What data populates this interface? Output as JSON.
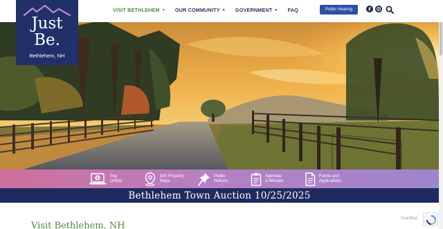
{
  "logo": {
    "line1": "Just",
    "line2": "Be.",
    "place": "Bethlehem, NH"
  },
  "nav": {
    "items": [
      {
        "label": "VISIT BETHLEHEM",
        "has_dropdown": true,
        "active": true
      },
      {
        "label": "OUR COMMUNITY",
        "has_dropdown": true,
        "active": false
      },
      {
        "label": "GOVERNMENT",
        "has_dropdown": true,
        "active": false
      },
      {
        "label": "FAQ",
        "has_dropdown": false,
        "active": false
      }
    ]
  },
  "header": {
    "cta_label": "Public Hearing",
    "social": [
      "facebook-icon",
      "instagram-icon"
    ],
    "search_icon": "search-icon"
  },
  "quick_links": [
    {
      "label": "Pay\nOnline",
      "icon": "laptop-dollar-icon"
    },
    {
      "label": "GIS Property\nMaps",
      "icon": "map-pin-icon"
    },
    {
      "label": "Public\nNotices",
      "icon": "pushpin-icon"
    },
    {
      "label": "Agendas\n& Minutes",
      "icon": "clipboard-icon"
    },
    {
      "label": "Forms and\nApplications",
      "icon": "document-icon"
    }
  ],
  "banner": {
    "text": "Bethlehem Town Auction 10/25/2025"
  },
  "section": {
    "title": "Visit Bethlehem, NH"
  },
  "widgets": {
    "scanmail_label": "ScanMail"
  },
  "colors": {
    "nav_active": "#4c8a3c",
    "nav": "#2d2f5e",
    "logo_bg": "#22306a",
    "button": "#2f4ea8",
    "banner_bg": "#1f2b5e",
    "quickbar_start": "#cf6f9a",
    "quickbar_end": "#9e85cf"
  }
}
